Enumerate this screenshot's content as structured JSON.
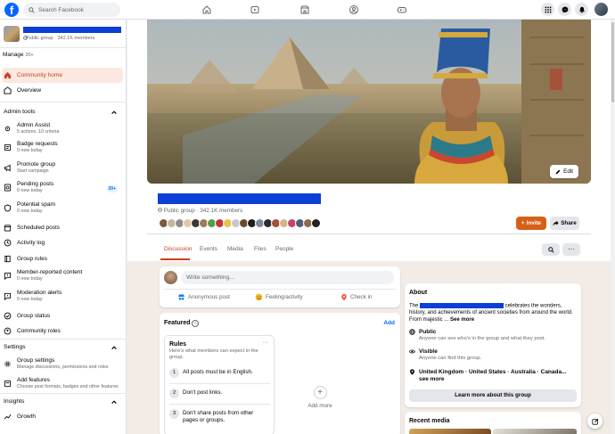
{
  "topbar": {
    "search_placeholder": "Search Facebook",
    "brand_color": "#0866ff"
  },
  "sidebar": {
    "group_subtitle": "Public group · 342.1K members",
    "manage_label": "Manage",
    "manage_count": "20+",
    "items_main": [
      {
        "label": "Community home",
        "icon": "home-icon",
        "active": true
      },
      {
        "label": "Overview",
        "icon": "overview-icon"
      }
    ],
    "admin_tools_header": "Admin tools",
    "admin_items": [
      {
        "label": "Admin Assist",
        "sub": "5 actions, 10 criteria"
      },
      {
        "label": "Badge requests",
        "sub": "0 new today"
      },
      {
        "label": "Promote group",
        "sub": "Start campaign"
      },
      {
        "label": "Pending posts",
        "sub": "0 new today",
        "badge": "20+"
      },
      {
        "label": "Potential spam",
        "sub": "0 new today"
      },
      {
        "label": "Scheduled posts"
      },
      {
        "label": "Activity log"
      },
      {
        "label": "Group rules"
      },
      {
        "label": "Member-reported content",
        "sub": "0 new today"
      },
      {
        "label": "Moderation alerts",
        "sub": "0 new today"
      },
      {
        "label": "Group status"
      },
      {
        "label": "Community roles"
      }
    ],
    "settings_header": "Settings",
    "settings_items": [
      {
        "label": "Group settings",
        "sub": "Manage discussions, permissions and roles"
      },
      {
        "label": "Add features",
        "sub": "Choose post formats, badges and other features"
      }
    ],
    "insights_header": "Insights",
    "insights_items": [
      {
        "label": "Growth"
      }
    ]
  },
  "header": {
    "edit_label": "Edit",
    "group_subtitle": "Public group · 342.1K members",
    "invite_label": "Invite",
    "share_label": "Share",
    "tabs": [
      "Discussion",
      "Events",
      "Media",
      "Files",
      "People"
    ]
  },
  "composer": {
    "placeholder": "Write something...",
    "actions": [
      "Anonymous post",
      "Feeling/activity",
      "Check in"
    ]
  },
  "featured": {
    "title": "Featured",
    "add_label": "Add",
    "rules_title": "Rules",
    "rules_desc": "Here's what members can expect in the group.",
    "rules": [
      {
        "num": "1",
        "text": "All posts must be in English."
      },
      {
        "num": "2",
        "text": "Don't post links."
      },
      {
        "num": "3",
        "text": "Don't share posts from other pages or groups."
      }
    ],
    "add_more_label": "Add more"
  },
  "about": {
    "title": "About",
    "desc_prefix": "The",
    "desc_suffix": "celebrates the wonders, history, and achievements of ancient societies from around the world. From majestic ...",
    "see_more": "See more",
    "public_title": "Public",
    "public_sub": "Anyone can see who's in the group and what they post.",
    "visible_title": "Visible",
    "visible_sub": "Anyone can find this group.",
    "location": "United Kingdom · United States · Australia · Canada...",
    "location_more": "see more",
    "learn_more": "Learn more about this group"
  },
  "recent_media": {
    "title": "Recent media"
  }
}
